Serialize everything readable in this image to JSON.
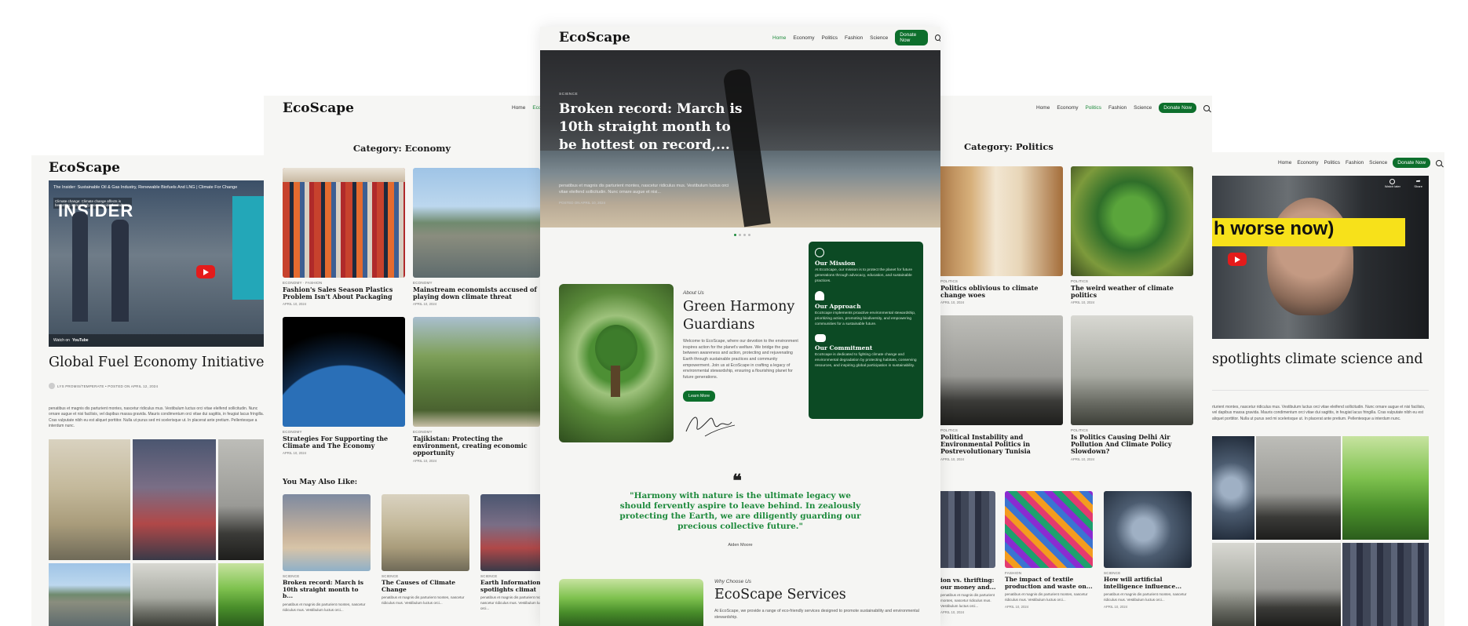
{
  "brand": "EcoScape",
  "nav": {
    "items": [
      "Home",
      "Economy",
      "Politics",
      "Fashion",
      "Science"
    ],
    "donate": "Donate Now",
    "accent": "#0d6f2c"
  },
  "left_panel": {
    "video_title": "The Insider: Sustainable Oil & Gas Industry, Renewable Biofuels And LNG | Climate For Change",
    "video_caption": "Climate change: Climate change affects is becoming increasingly worse inside the industry",
    "video_badge": "INSIDER",
    "watch_on": "Watch on",
    "youtube": "YouTube",
    "headline": "Global Fuel Economy Initiative",
    "byline": "LYS PROMIS/TEMPERATE • POSTED ON APRIL 12, 2024",
    "body": "penatibus et magnis dis parturient montes, nascetur ridiculus mus. Vestibulum luctus orci vitae eleifend sollicitudin. Nunc ornare augue et nisi facilisis, vel dapibus massa gravida. Mauris condimentum orci vitae dui sagittis, in feugiat lacus fringilla. Cras vulputate nibh eu est aliquet porttitor. Nulla ut purus sed mi scelerisque ut. In placerat ante pretium. Pellentesque a interdum nunc."
  },
  "economy_panel": {
    "category_title": "Category: Economy",
    "articles": [
      {
        "meta": "ECONOMY · FASHION",
        "title": "Fashion's Sales Season Plastics Problem Isn't About Packaging",
        "date": "APRIL 10, 2024"
      },
      {
        "meta": "ECONOMY",
        "title": "Mainstream economists accused of playing down climate threat",
        "date": "APRIL 10, 2024"
      },
      {
        "meta": "ECONOMY",
        "title": "Strategies For Supporting the Climate and The Economy",
        "date": "APRIL 10, 2024"
      },
      {
        "meta": "ECONOMY",
        "title": "Tajikistan: Protecting the environment, creating economic opportunity",
        "date": "APRIL 10, 2024"
      }
    ],
    "also_like_title": "You May Also Like:",
    "also_like": [
      {
        "meta": "SCIENCE",
        "title": "Broken record: March is 10th straight month to b...",
        "excerpt": "penatibus et magnis dis parturient montes, nascetur ridiculus mus. Vestibulum luctus orci..."
      },
      {
        "meta": "SCIENCE",
        "title": "The Causes of Climate Change",
        "excerpt": "penatibus et magnis dis parturient montes, nascetur ridiculus mus. Vestibulum luctus orci..."
      },
      {
        "meta": "SCIENCE",
        "title": "Earth Information spotlights climat",
        "excerpt": "penatibus et magnis dis parturient montes, nascetur ridiculus mus. Vestibulum luctus orci..."
      }
    ]
  },
  "center_panel": {
    "hero": {
      "category": "SCIENCE",
      "title": "Broken record: March is 10th straight month to be hottest on record,...",
      "excerpt": "penatibus et magnis dis parturient montes, nascetur ridiculus mus. Vestibulum luctus orci vitae eleifend sollicitudin. Nunc ornare augue et nisi...",
      "date": "POSTED ON APRIL 10, 2024",
      "slide_index": 0,
      "slide_count": 4
    },
    "about": {
      "kicker": "About Us",
      "title": "Green Harmony Guardians",
      "body": "Welcome to EcoScape, where our devotion to the environment inspires action for the planet's welfare. We bridge the gap between awareness and action, protecting and rejuvenating Earth through sustainable practices and community empowerment. Join us at EcoScape in crafting a legacy of environmental stewardship, ensuring a flourishing planet for future generations.",
      "button": "Learn More"
    },
    "mission_card": [
      {
        "title": "Our Mission",
        "body": "At EcoScape, our mission is to protect the planet for future generations through advocacy, education, and sustainable practices.",
        "icon": "globe-icon"
      },
      {
        "title": "Our Approach",
        "body": "EcoScape implements proactive environmental stewardship, prioritizing action, promoting biodiversity, and empowering communities for a sustainable future.",
        "icon": "seedling-hand-icon"
      },
      {
        "title": "Our Commitment",
        "body": "EcoScape is dedicated to fighting climate change and environmental degradation by protecting habitats, conserving resources, and inspiring global participation in sustainability.",
        "icon": "handshake-icon"
      }
    ],
    "quote": {
      "text": "\"Harmony with nature is the ultimate legacy we should fervently aspire to leave behind. In zealously protecting the Earth, we are diligently guarding our precious collective future.\"",
      "author": "Aiden Moore",
      "accent": "#1e8a3c"
    },
    "services": {
      "kicker": "Why Choose Us",
      "title": "EcoScape Services",
      "body": "At EcoScape, we provide a range of eco-friendly services designed to promote sustainability and environmental stewardship."
    }
  },
  "politics_panel": {
    "category_title": "Category: Politics",
    "articles": [
      {
        "meta": "POLITICS",
        "title": "Politics oblivious to climate change woes",
        "date": "APRIL 10, 2024"
      },
      {
        "meta": "POLITICS",
        "title": "The weird weather of climate politics",
        "date": "APRIL 10, 2024"
      },
      {
        "meta": "POLITICS",
        "title": "Political Instability and Environmental Politics in Postrevolutionary Tunisia",
        "date": "APRIL 10, 2024"
      },
      {
        "meta": "POLITICS",
        "title": "Is Politics Causing Delhi Air Pollution And Climate Policy Slowdown?",
        "date": "APRIL 10, 2024"
      }
    ],
    "bottom": [
      {
        "meta": "",
        "title": "ion vs. thrifting: our money and...",
        "excerpt": "penatibus et magnis dis parturient montes, nascetur ridiculus mus. Vestibulum luctus orci...",
        "date": "APRIL 10, 2024"
      },
      {
        "meta": "FASHION",
        "title": "The impact of textile production and waste on...",
        "excerpt": "penatibus et magnis dis parturient montes, nascetur ridiculus mus. Vestibulum luctus orci...",
        "date": "APRIL 10, 2024"
      },
      {
        "meta": "SCIENCE",
        "title": "How will artificial intelligence influence...",
        "excerpt": "penatibus et magnis dis parturient montes, nascetur ridiculus mus. Vestibulum luctus orci...",
        "date": "APRIL 10, 2024"
      }
    ]
  },
  "right_panel": {
    "video_banner": "h worse now)",
    "watch_later": "Watch later",
    "share": "Share",
    "headline": "spotlights climate science and",
    "body": "rturient montes, nascetur ridiculus mus. Vestibulum luctus orci vitae eleifend sollicitudin. Nunc ornare augue et nisi facilisis, vel dapibus massa gravida. Mauris condimentum orci vitae dui sagittis, in feugiat lacus fringilla. Cras vulputate nibh eu est aliquet porttitor. Nulla ut purus sed mi scelerisque ut. In placerat ante pretium. Pellentesque a interdum nunc."
  }
}
